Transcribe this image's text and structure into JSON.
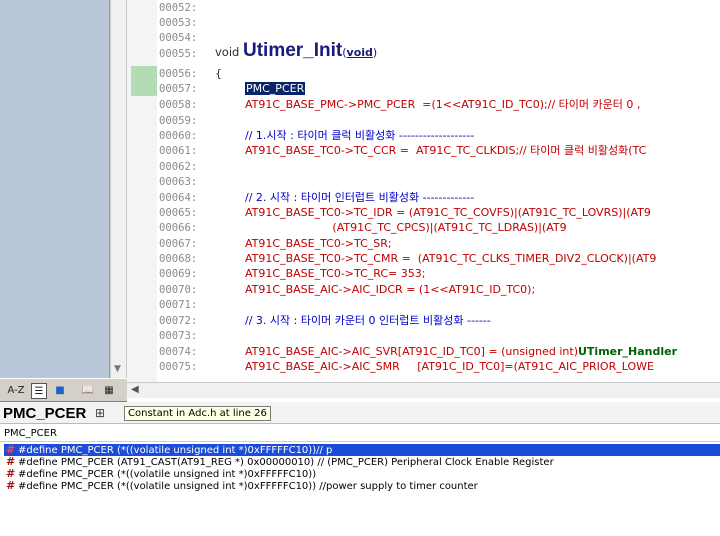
{
  "editor": {
    "lines": [
      {
        "num": "00052:",
        "text": ""
      },
      {
        "num": "00053:",
        "text": ""
      },
      {
        "num": "00054:",
        "text": ""
      },
      {
        "num": "00055:",
        "kw": "void",
        "fn": "Utimer_Init",
        "arg": "void"
      },
      {
        "num": "00056:",
        "text": "{"
      },
      {
        "num": "00057:",
        "selected": "PMC_PCER"
      },
      {
        "num": "00058:",
        "text": "AT91C_BASE_PMC->PMC_PCER  =(1<<AT91C_ID_TC0);// 타이머 카운터 0 ,"
      },
      {
        "num": "00059:",
        "text": ""
      },
      {
        "num": "00060:",
        "text": "// 1.시작 : 타이머 클럭 비활성화 -------------------"
      },
      {
        "num": "00061:",
        "text": "AT91C_BASE_TC0->TC_CCR =  AT91C_TC_CLKDIS;// 타이머 클럭 비활성화(TC"
      },
      {
        "num": "00062:",
        "text": ""
      },
      {
        "num": "00063:",
        "text": ""
      },
      {
        "num": "00064:",
        "text": "// 2. 시작 : 타이머 인터럽트 비활성화 -------------"
      },
      {
        "num": "00065:",
        "text": "AT91C_BASE_TC0->TC_IDR = (AT91C_TC_COVFS)|(AT91C_TC_LOVRS)|(AT9"
      },
      {
        "num": "00066:",
        "text": "                         (AT91C_TC_CPCS)|(AT91C_TC_LDRAS)|(AT9"
      },
      {
        "num": "00067:",
        "text": "AT91C_BASE_TC0->TC_SR;"
      },
      {
        "num": "00068:",
        "text": "AT91C_BASE_TC0->TC_CMR =  (AT91C_TC_CLKS_TIMER_DIV2_CLOCK)|(AT9"
      },
      {
        "num": "00069:",
        "text": "AT91C_BASE_TC0->TC_RC= 353;"
      },
      {
        "num": "00070:",
        "text": "AT91C_BASE_AIC->AIC_IDCR = (1<<AT91C_ID_TC0);"
      },
      {
        "num": "00071:",
        "text": ""
      },
      {
        "num": "00072:",
        "text": "// 3. 시작 : 타이머 카운터 0 인터럽트 비활성화 ------"
      },
      {
        "num": "00073:",
        "text": ""
      },
      {
        "num": "00074:",
        "pre": "AT91C_BASE_AIC->AIC_SVR[AT91C_ID_TC0] = (unsigned int)",
        "green": "UTimer_Handler"
      },
      {
        "num": "00075:",
        "text": "AT91C_BASE_AIC->AIC_SMR     [AT91C_ID_TC0]=(AT91C_AIC_PRIOR_LOWE"
      }
    ]
  },
  "toolbar": {
    "az_label": "A-Z"
  },
  "context": {
    "symbol": "PMC_PCER",
    "tooltip": "Constant in Adc.h at line 26",
    "input_value": "PMC_PCER",
    "definitions": [
      "#define PMC_PCER (*((volatile unsigned int *)0xFFFFFC10))// p",
      "#define PMC_PCER (AT91_CAST(AT91_REG *) 0x00000010) // (PMC_PCER) Peripheral Clock Enable Register",
      "#define PMC_PCER (*((volatile unsigned int *)0xFFFFFC10))",
      "#define PMC_PCER (*((volatile unsigned int *)0xFFFFFC10)) //power supply to timer counter"
    ]
  },
  "colors": {
    "code_red": "#c00000",
    "comment_blue": "#0000c8",
    "selection": "#0a246a",
    "list_selection": "#1c4cd8",
    "tree_pane": "#b8c6d7"
  },
  "icons": [
    "sort-alpha-icon",
    "list-view-icon",
    "category-view-icon",
    "book-icon",
    "properties-icon",
    "scroll-left-icon",
    "scroll-down-icon",
    "tree-icon",
    "define-hash-icon"
  ]
}
